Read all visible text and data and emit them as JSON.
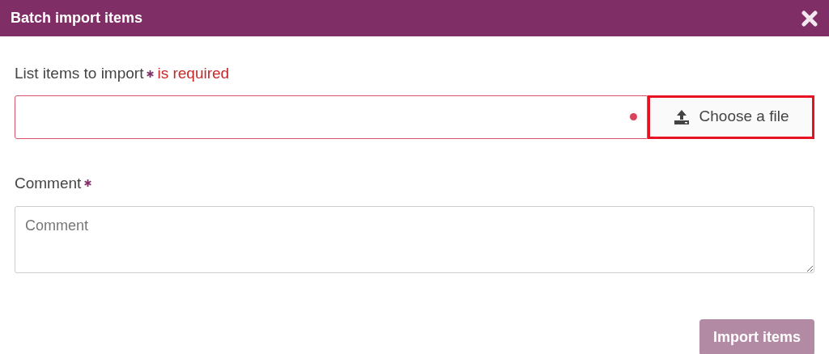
{
  "dialog": {
    "title": "Batch import items"
  },
  "items_field": {
    "label": "List items to import",
    "required": true,
    "error": "is required",
    "invalid": true
  },
  "file_button": {
    "label": "Choose a file",
    "focused": true
  },
  "comment_field": {
    "label": "Comment",
    "required": true,
    "placeholder": "Comment"
  },
  "submit_button": {
    "label": "Import items",
    "disabled": true
  }
}
